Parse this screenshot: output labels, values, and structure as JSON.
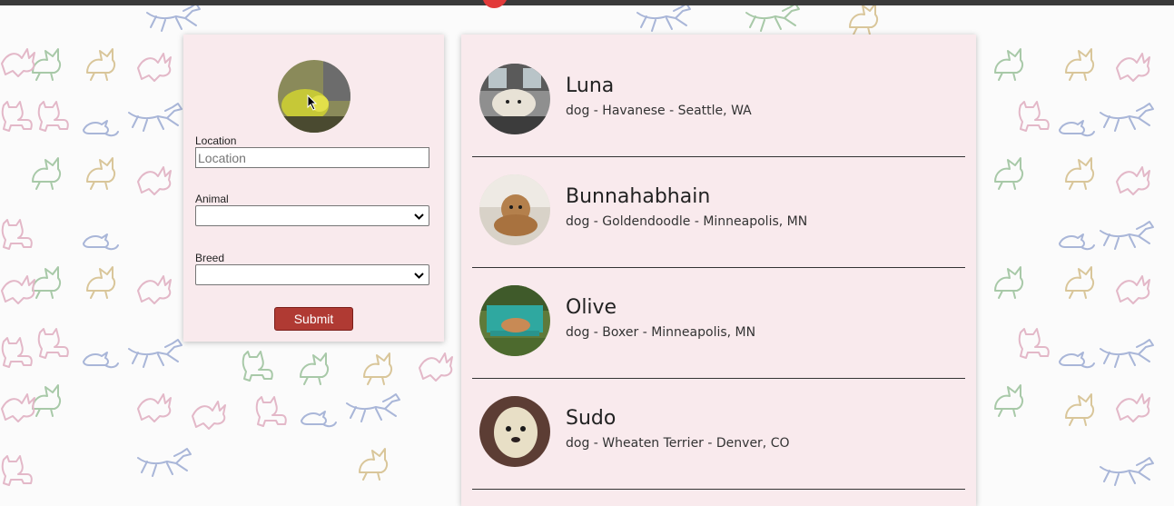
{
  "search_form": {
    "location_label": "Location",
    "location_value": "",
    "location_placeholder": "Location",
    "animal_label": "Animal",
    "animal_selected": "",
    "breed_label": "Breed",
    "breed_selected": "",
    "submit_label": "Submit"
  },
  "results": [
    {
      "name": "Luna",
      "info": "dog - Havanese - Seattle, WA"
    },
    {
      "name": "Bunnahabhain",
      "info": "dog - Goldendoodle - Minneapolis, MN"
    },
    {
      "name": "Olive",
      "info": "dog - Boxer - Minneapolis, MN"
    },
    {
      "name": "Sudo",
      "info": "dog - Wheaten Terrier - Denver, CO"
    }
  ],
  "colors": {
    "panel_bg": "#f9eaed",
    "button_bg": "#b03a33",
    "pattern_colors": [
      "#a8c9a8",
      "#e3b8c8",
      "#a9b6d8",
      "#d9c69a"
    ]
  },
  "icons": [
    "chevron-down-icon",
    "mouse-cursor-icon",
    "animal-pattern"
  ]
}
